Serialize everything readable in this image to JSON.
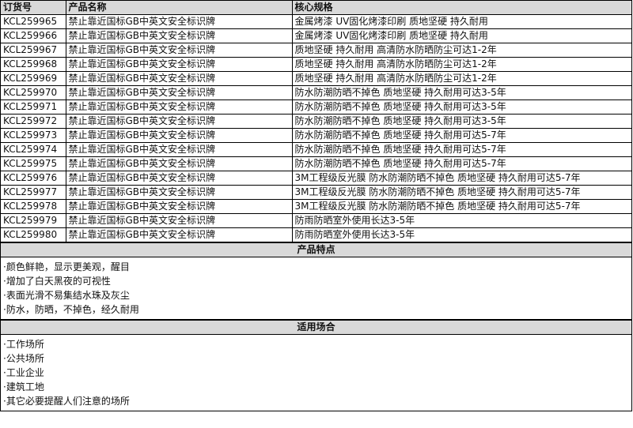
{
  "headers": {
    "col1": "订货号",
    "col2": "产品名称",
    "col3": "核心规格"
  },
  "rows": [
    {
      "code": "KCL259965",
      "name": "禁止靠近国标GB中英文安全标识牌",
      "spec": "金属烤漆 UV固化烤漆印刷 质地坚硬 持久耐用"
    },
    {
      "code": "KCL259966",
      "name": "禁止靠近国标GB中英文安全标识牌",
      "spec": "金属烤漆 UV固化烤漆印刷 质地坚硬 持久耐用"
    },
    {
      "code": "KCL259967",
      "name": "禁止靠近国标GB中英文安全标识牌",
      "spec": "质地坚硬 持久耐用 高清防水防晒防尘可达1-2年"
    },
    {
      "code": "KCL259968",
      "name": "禁止靠近国标GB中英文安全标识牌",
      "spec": "质地坚硬 持久耐用 高清防水防晒防尘可达1-2年"
    },
    {
      "code": "KCL259969",
      "name": "禁止靠近国标GB中英文安全标识牌",
      "spec": "质地坚硬 持久耐用 高清防水防晒防尘可达1-2年"
    },
    {
      "code": "KCL259970",
      "name": "禁止靠近国标GB中英文安全标识牌",
      "spec": "防水防潮防晒不掉色 质地坚硬 持久耐用可达3-5年"
    },
    {
      "code": "KCL259971",
      "name": "禁止靠近国标GB中英文安全标识牌",
      "spec": "防水防潮防晒不掉色 质地坚硬 持久耐用可达3-5年"
    },
    {
      "code": "KCL259972",
      "name": "禁止靠近国标GB中英文安全标识牌",
      "spec": "防水防潮防晒不掉色 质地坚硬 持久耐用可达3-5年"
    },
    {
      "code": "KCL259973",
      "name": "禁止靠近国标GB中英文安全标识牌",
      "spec": "防水防潮防晒不掉色 质地坚硬 持久耐用可达5-7年"
    },
    {
      "code": "KCL259974",
      "name": "禁止靠近国标GB中英文安全标识牌",
      "spec": "防水防潮防晒不掉色 质地坚硬 持久耐用可达5-7年"
    },
    {
      "code": "KCL259975",
      "name": "禁止靠近国标GB中英文安全标识牌",
      "spec": "防水防潮防晒不掉色 质地坚硬 持久耐用可达5-7年"
    },
    {
      "code": "KCL259976",
      "name": "禁止靠近国标GB中英文安全标识牌",
      "spec": "3M工程级反光膜 防水防潮防晒不掉色 质地坚硬 持久耐用可达5-7年"
    },
    {
      "code": "KCL259977",
      "name": "禁止靠近国标GB中英文安全标识牌",
      "spec": "3M工程级反光膜 防水防潮防晒不掉色 质地坚硬 持久耐用可达5-7年"
    },
    {
      "code": "KCL259978",
      "name": "禁止靠近国标GB中英文安全标识牌",
      "spec": "3M工程级反光膜 防水防潮防晒不掉色 质地坚硬 持久耐用可达5-7年"
    },
    {
      "code": "KCL259979",
      "name": "禁止靠近国标GB中英文安全标识牌",
      "spec": "防雨防晒室外使用长达3-5年"
    },
    {
      "code": "KCL259980",
      "name": "禁止靠近国标GB中英文安全标识牌",
      "spec": "防雨防晒室外使用长达3-5年"
    }
  ],
  "features": {
    "title": "产品特点",
    "items": [
      "·颜色鲜艳，显示更美观，醒目",
      "·增加了白天黑夜的可视性",
      "·表面光滑不易集结水珠及灰尘",
      "·防水，防晒，不掉色，经久耐用"
    ]
  },
  "usage": {
    "title": "适用场合",
    "items": [
      "·工作场所",
      "·公共场所",
      "·工业企业",
      "·建筑工地",
      "·其它必要提醒人们注意的场所"
    ]
  }
}
